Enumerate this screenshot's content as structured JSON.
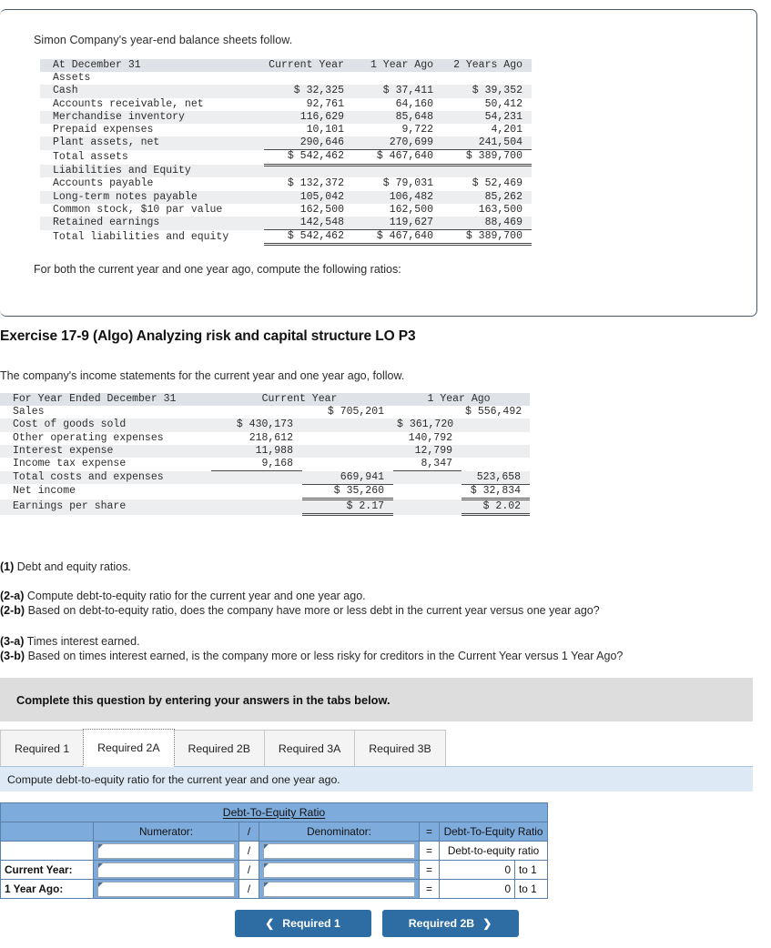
{
  "top_panel": {
    "intro": "Simon Company's year-end balance sheets follow.",
    "closing_note": "For both the current year and one year ago, compute the following ratios:",
    "balance_sheet": {
      "header": [
        "At December 31",
        "Current Year",
        "1 Year Ago",
        "2 Years Ago"
      ],
      "section_assets": "Assets",
      "asset_rows": [
        {
          "label": "Cash",
          "values": [
            "$ 32,325",
            "$ 37,411",
            "$ 39,352"
          ]
        },
        {
          "label": "Accounts receivable, net",
          "values": [
            "92,761",
            "64,160",
            "50,412"
          ]
        },
        {
          "label": "Merchandise inventory",
          "values": [
            "116,629",
            "85,648",
            "54,231"
          ]
        },
        {
          "label": "Prepaid expenses",
          "values": [
            "10,101",
            "9,722",
            "4,201"
          ]
        },
        {
          "label": "Plant assets, net",
          "values": [
            "290,646",
            "270,699",
            "241,504"
          ]
        }
      ],
      "total_assets": {
        "label": "Total assets",
        "values": [
          "$ 542,462",
          "$ 467,640",
          "$ 389,700"
        ]
      },
      "section_liab": "Liabilities and Equity",
      "liab_rows": [
        {
          "label": "Accounts payable",
          "values": [
            "$ 132,372",
            "$ 79,031",
            "$ 52,469"
          ]
        },
        {
          "label": "Long-term notes payable",
          "values": [
            "105,042",
            "106,482",
            "85,262"
          ]
        },
        {
          "label": "Common stock, $10 par value",
          "values": [
            "162,500",
            "162,500",
            "163,500"
          ]
        },
        {
          "label": "Retained earnings",
          "values": [
            "142,548",
            "119,627",
            "88,469"
          ]
        }
      ],
      "total_liab": {
        "label": "Total liabilities and equity",
        "values": [
          "$ 542,462",
          "$ 467,640",
          "$ 389,700"
        ]
      }
    }
  },
  "exercise": {
    "heading": "Exercise 17-9 (Algo) Analyzing risk and capital structure LO P3",
    "subheading": "The company's income statements for the current year and one year ago, follow."
  },
  "income_statement": {
    "header": [
      "For Year Ended December 31",
      "Current Year",
      "1 Year Ago"
    ],
    "rows": [
      {
        "label": "Sales",
        "a": "",
        "b": "$ 705,201",
        "c": "",
        "d": "$ 556,492"
      },
      {
        "label": "Cost of goods sold",
        "a": "$ 430,173",
        "b": "",
        "c": "$ 361,720",
        "d": ""
      },
      {
        "label": "Other operating expenses",
        "a": "218,612",
        "b": "",
        "c": "140,792",
        "d": ""
      },
      {
        "label": "Interest expense",
        "a": "11,988",
        "b": "",
        "c": "12,799",
        "d": ""
      },
      {
        "label": "Income tax expense",
        "a": "9,168",
        "b": "",
        "c": "8,347",
        "d": ""
      },
      {
        "label": "Total costs and expenses",
        "a": "",
        "b": "669,941",
        "c": "",
        "d": "523,658"
      },
      {
        "label": "Net income",
        "a": "",
        "b": "$ 35,260",
        "c": "",
        "d": "$ 32,834"
      },
      {
        "label": "Earnings per share",
        "a": "",
        "b": "$ 2.17",
        "c": "",
        "d": "$ 2.02"
      }
    ]
  },
  "questions": {
    "q1_num": "(1)",
    "q1_text": "Debt and equity ratios.",
    "q2a_num": "(2-a)",
    "q2a_text": "Compute debt-to-equity ratio for the current year and one year ago.",
    "q2b_num": "(2-b)",
    "q2b_text": "Based on debt-to-equity ratio, does the company have more or less debt in the current year versus one year ago?",
    "q3a_num": "(3-a)",
    "q3a_text": "Times interest earned.",
    "q3b_num": "(3-b)",
    "q3b_text": "Based on times interest earned, is the company more or less risky for creditors in the Current Year versus 1 Year Ago?"
  },
  "banner": {
    "text": "Complete this question by entering your answers in the tabs below."
  },
  "tabs": {
    "items": [
      {
        "label": "Required 1",
        "active": false
      },
      {
        "label": "Required 2A",
        "active": true
      },
      {
        "label": "Required 2B",
        "active": false
      },
      {
        "label": "Required 3A",
        "active": false
      },
      {
        "label": "Required 3B",
        "active": false
      }
    ]
  },
  "instruction": {
    "text": "Compute debt-to-equity ratio for the current year and one year ago."
  },
  "answer_table": {
    "title": "Debt-To-Equity Ratio",
    "headers": {
      "numerator": "Numerator:",
      "slash": "/",
      "denominator": "Denominator:",
      "equals": "=",
      "result": "Debt-To-Equity Ratio"
    },
    "rows": [
      {
        "label": "",
        "numerator": "",
        "slash": "/",
        "denominator": "",
        "equals": "=",
        "result": "Debt-to-equity ratio",
        "suffix": ""
      },
      {
        "label": "Current Year:",
        "numerator": "",
        "slash": "/",
        "denominator": "",
        "equals": "=",
        "result": "0",
        "suffix": "to 1"
      },
      {
        "label": "1 Year Ago:",
        "numerator": "",
        "slash": "/",
        "denominator": "",
        "equals": "=",
        "result": "0",
        "suffix": "to 1"
      }
    ]
  },
  "nav": {
    "prev_label": "Required 1",
    "prev_icon": "chevron-left-icon",
    "next_label": "Required 2B",
    "next_icon": "chevron-right-icon"
  },
  "colors": {
    "table_header_band": "#dfe2e6",
    "row_shade": "#eceef0",
    "answer_blue": "#7dabdc",
    "instruction_blue": "#ddeaf6",
    "banner_grey": "#dddddd",
    "button_blue": "#2e6da4"
  }
}
